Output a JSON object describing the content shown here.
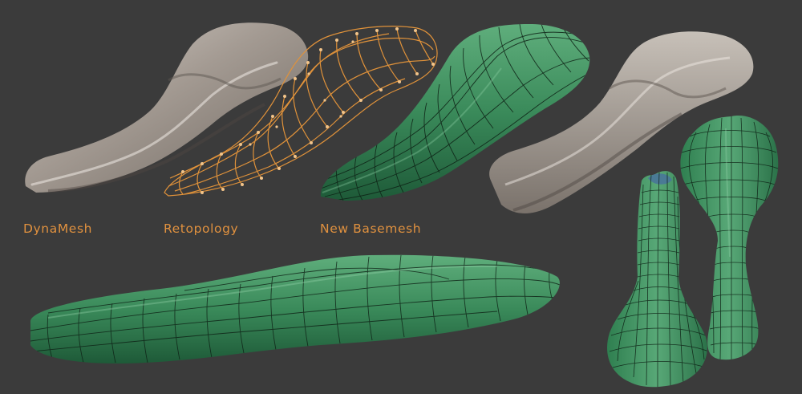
{
  "labels": {
    "dynamesh": "DynaMesh",
    "retopology": "Retopology",
    "new_basemesh": "New Basemesh"
  },
  "colors": {
    "background": "#3b3b3b",
    "label_orange": "#e0913f",
    "clay_gray": "#8c847e",
    "clay_highlight": "#c9c2bb",
    "retopo_wire": "#e0923a",
    "mesh_green": "#2f7a4e",
    "mesh_green_light": "#57a876",
    "wire_black": "#0d1a12"
  },
  "icons": [
    "dynamesh-sculpt",
    "retopology-wireframe",
    "new-basemesh",
    "sole-side-view",
    "sole-bottom-view",
    "sole-top-view"
  ]
}
